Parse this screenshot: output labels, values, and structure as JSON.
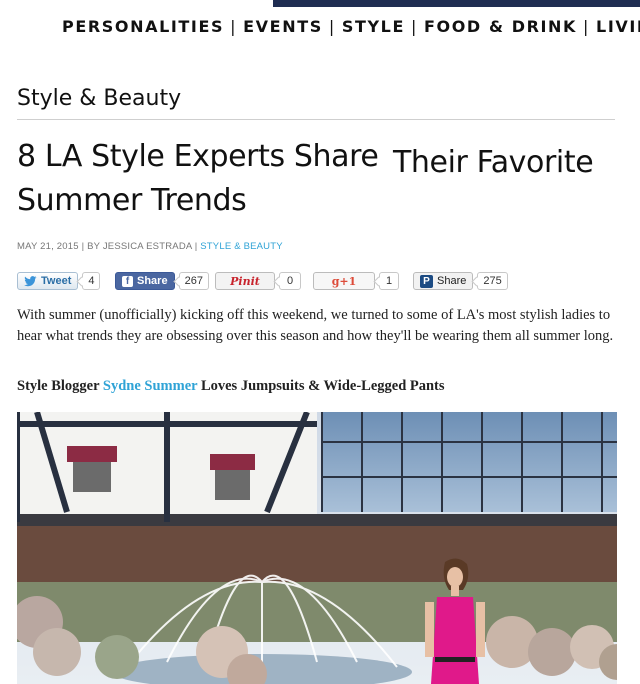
{
  "nav": {
    "items": [
      "PERSONALITIES",
      "EVENTS",
      "STYLE",
      "FOOD & DRINK",
      "LIVING"
    ],
    "separator": "|"
  },
  "section_title": "Style & Beauty",
  "article": {
    "title_line1_a": "8 LA Style Experts Share",
    "title_line1_b": "Their Favorite",
    "title_line2": "Summer Trends",
    "date": "MAY 21, 2015",
    "byline": "BY JESSICA ESTRADA",
    "category": "STYLE & BEAUTY",
    "intro": "With summer (unofficially) kicking off this weekend, we turned to some of LA's most stylish ladies to hear what trends they are obsessing over this season and how they'll be wearing them all summer long.",
    "subhead_prefix": "Style Blogger",
    "subhead_link": "Sydne Summer",
    "subhead_suffix": "Loves Jumpsuits & Wide-Legged Pants"
  },
  "share": [
    {
      "label": "Tweet",
      "count": "4",
      "icon": "twitter-bird-icon"
    },
    {
      "label": "Share",
      "count": "267",
      "icon": "facebook-icon"
    },
    {
      "label": "Pinit",
      "count": "0",
      "icon": "pinterest-icon"
    },
    {
      "label": "+1",
      "count": "1",
      "icon": "google-plus-icon"
    },
    {
      "label": "Share",
      "count": "275",
      "icon": "p-share-icon"
    }
  ],
  "colors": {
    "link": "#2fa3d6",
    "topbar": "#1f2d52",
    "facebook": "#4b67a1",
    "pinterest": "#c8232c",
    "dress": "#e0198a"
  }
}
